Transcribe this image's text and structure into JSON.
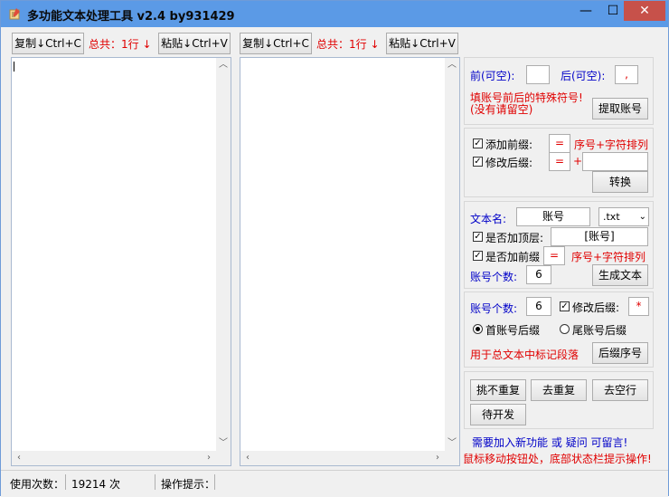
{
  "window": {
    "title": "多功能文本处理工具 v2.4 by931429",
    "min_glyph": "—",
    "max_glyph": "☐",
    "close_glyph": "✕"
  },
  "left_toolbar": {
    "copy_label": "复制↓Ctrl+C",
    "total_label": "总共：1行 ↓",
    "paste_label": "粘贴↓Ctrl+V"
  },
  "right_toolbar": {
    "copy_label": "复制↓Ctrl+C",
    "total_label": "总共：1行 ↓",
    "paste_label": "粘贴↓Ctrl+V"
  },
  "panel_extract": {
    "before_label": "前(可空):",
    "before_value": "",
    "after_label": "后(可空):",
    "after_value": ",",
    "hint_line1": "填账号前后的特殊符号!",
    "hint_line2": "(没有请留空)",
    "extract_button": "提取账号"
  },
  "panel_convert": {
    "add_prefix_label": "添加前缀:",
    "add_prefix_checked": true,
    "prefix_value": "=",
    "prefix_hint": "序号+字符排列",
    "modify_suffix_label": "修改后缀:",
    "modify_suffix_checked": true,
    "suffix_value": "=",
    "plus_sign": "+",
    "suffix_extra_value": "",
    "convert_button": "转换"
  },
  "panel_generate": {
    "filename_label": "文本名:",
    "filename_value": "账号",
    "ext_value": ".txt",
    "top_label": "是否加顶层:",
    "top_checked": true,
    "top_value": "[账号]",
    "prefix_label": "是否加前缀",
    "prefix_checked": true,
    "prefix_value": "=",
    "prefix_hint": "序号+字符排列",
    "count_label": "账号个数:",
    "count_value": "6",
    "generate_button": "生成文本"
  },
  "panel_suffix": {
    "count_label": "账号个数:",
    "count_value": "6",
    "modify_suffix_label": "修改后缀:",
    "modify_suffix_checked": true,
    "suffix_value": "*",
    "radio_first_label": "首账号后缀",
    "radio_first_selected": true,
    "radio_last_label": "尾账号后缀",
    "radio_last_selected": false,
    "hint": "用于总文本中标记段落",
    "suffix_seq_button": "后缀序号"
  },
  "panel_actions": {
    "pick_unique_button": "挑不重复",
    "dedupe_button": "去重复",
    "remove_blank_button": "去空行",
    "todo_button": "待开发"
  },
  "footer_notes": {
    "line1_part1": "需要加入新功能",
    "line1_part2": "或",
    "line1_part3": "疑问",
    "line1_part4": "可留言!",
    "line2": "鼠标移动按钮处，底部状态栏提示操作!"
  },
  "statusbar": {
    "usage_label": "使用次数：",
    "usage_value": "19214 次",
    "hint_label": "操作提示："
  },
  "colors": {
    "titlebar": "#5b9ae6",
    "close_button": "#c7514a",
    "accent_red": "#e00000",
    "accent_blue": "#0000c8"
  }
}
